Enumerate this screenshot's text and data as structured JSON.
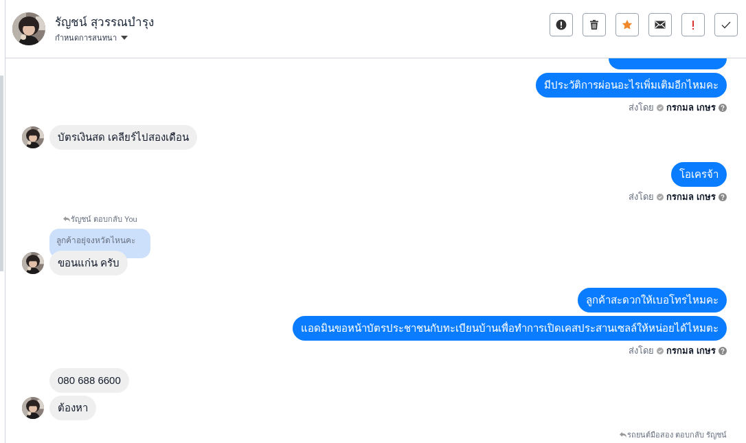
{
  "header": {
    "name": "รัญชน์ สุวรรณบำรุง",
    "subtitle": "กำหนดการสนทนา"
  },
  "toolbar": [
    {
      "kind": "alert"
    },
    {
      "kind": "trash"
    },
    {
      "kind": "star"
    },
    {
      "kind": "mail"
    },
    {
      "kind": "important"
    },
    {
      "kind": "done"
    }
  ],
  "messages": [
    {
      "kind": "outgoing",
      "cut_bubble_above": true,
      "bubbles": [
        "มีประวัติการผ่อนอะไรเพิ่มเติมอีกไหมคะ"
      ],
      "sent_by": {
        "prefix": "ส่งโดย",
        "agent": "กรกมล เกษร"
      }
    },
    {
      "kind": "incoming",
      "bubbles": [
        "บัตรเงินสด เคลียร์ไปสองเดือน"
      ]
    },
    {
      "kind": "outgoing",
      "bubbles": [
        "โอเครจ้า"
      ],
      "sent_by": {
        "prefix": "ส่งโดย",
        "agent": "กรกมล เกษร"
      }
    },
    {
      "kind": "incoming",
      "reply_note": "รัญชน์ ตอบกลับ You",
      "quote": "ลูกค้าอยุ่จงหวัดไหนคะ",
      "bubbles": [
        "ขอนแก่น ครับ"
      ]
    },
    {
      "kind": "outgoing",
      "bubbles": [
        "ลูกค้าสะดวกให้เบอโทรไหมคะ",
        "แอดมินขอหน้าบัตรประชาชนกับทะเบียนบ้านเพื่อทำการเปิดเคสประสานเซลล์ให้หน่อยได้ไหมตะ"
      ],
      "sent_by": {
        "prefix": "ส่งโดย",
        "agent": "กรกมล เกษร"
      }
    },
    {
      "kind": "incoming",
      "bubbles": [
        "080 688 6600",
        "ต้องหา"
      ]
    },
    {
      "kind": "outgoing_note",
      "reply_note": "รถยนต์มือสอง ตอบกลับ รัญชน์"
    }
  ]
}
